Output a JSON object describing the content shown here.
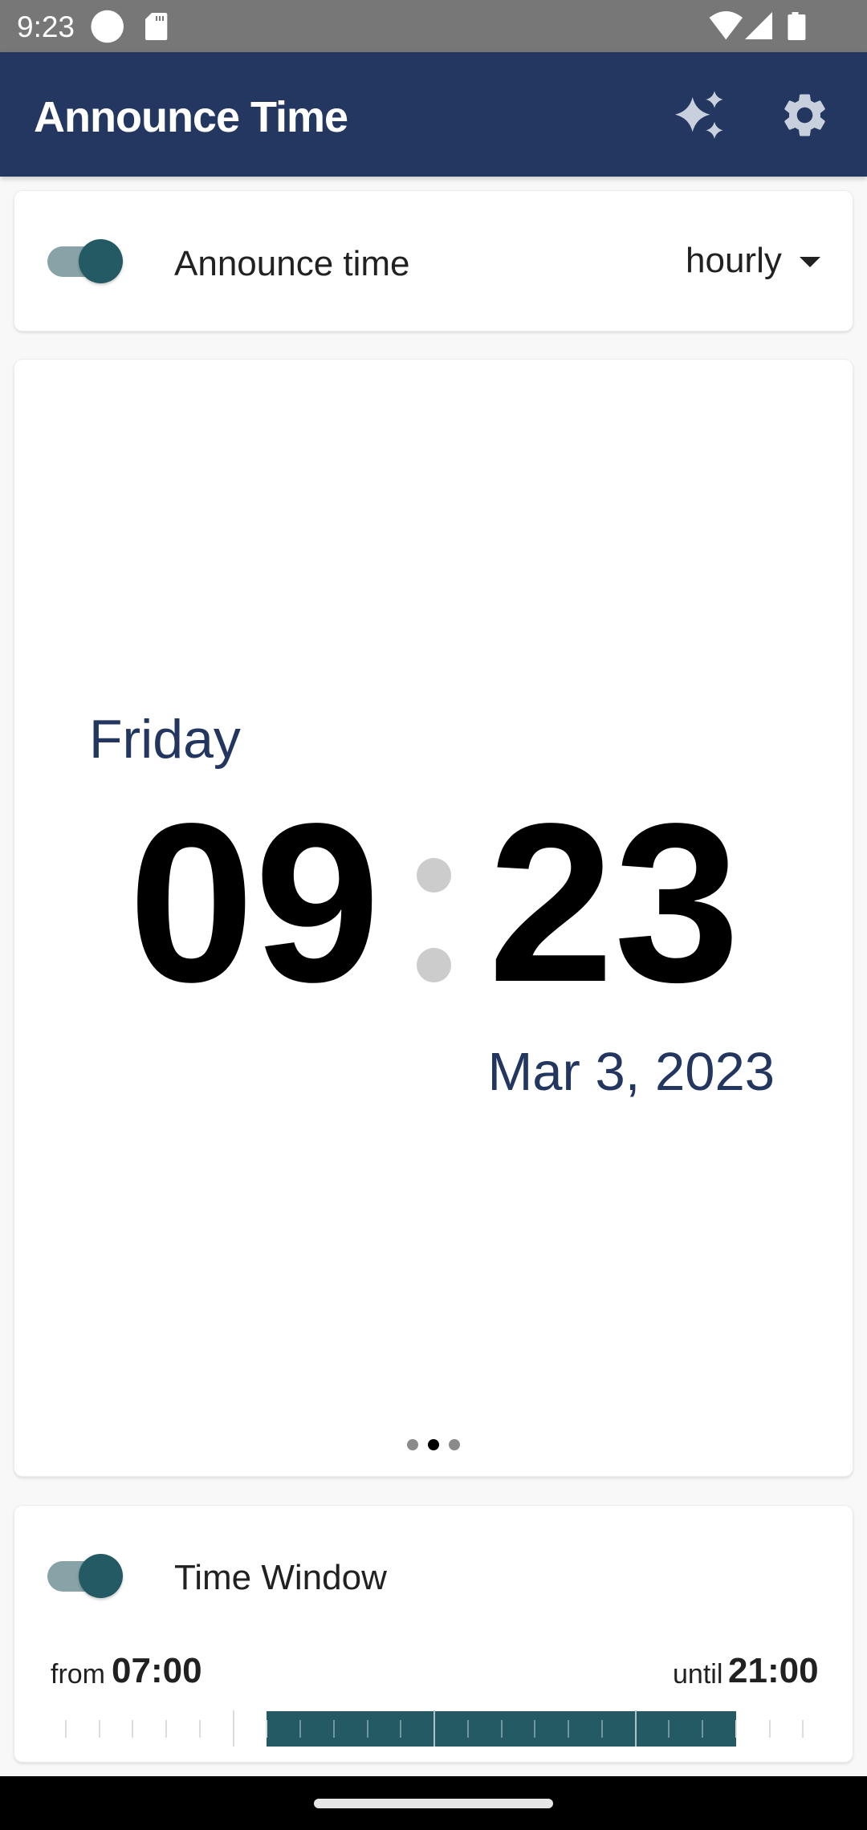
{
  "status_bar": {
    "time": "9:23",
    "icons": [
      "notification-dot-icon",
      "sd-card-icon",
      "wifi-icon",
      "cell-signal-icon",
      "battery-icon"
    ]
  },
  "app_bar": {
    "title": "Announce Time",
    "actions": [
      {
        "name": "sparkle",
        "icon": "sparkle-icon"
      },
      {
        "name": "settings",
        "icon": "gear-icon"
      }
    ]
  },
  "announce_card": {
    "toggle_on": true,
    "label": "Announce time",
    "interval": {
      "selected": "hourly"
    }
  },
  "clock_card": {
    "weekday": "Friday",
    "hours": "09",
    "minutes": "23",
    "date": "Mar 3, 2023",
    "pager": {
      "count": 3,
      "active_index": 1
    }
  },
  "time_window_card": {
    "toggle_on": true,
    "label": "Time Window",
    "from_label": "from",
    "from_time": "07:00",
    "until_label": "until",
    "until_time": "21:00",
    "timeline": {
      "scale_hours": 24,
      "window_start_hour": 7,
      "window_end_hour": 21,
      "major_tick_interval_hours": 6
    }
  },
  "colors": {
    "app_bar": "#233761",
    "accent": "#245a63",
    "accent_light": "#87a3a8",
    "text_navy": "#22365f",
    "icon_light": "#c9d0dd",
    "colon": "#cccccc",
    "status_bar": "#777777"
  }
}
